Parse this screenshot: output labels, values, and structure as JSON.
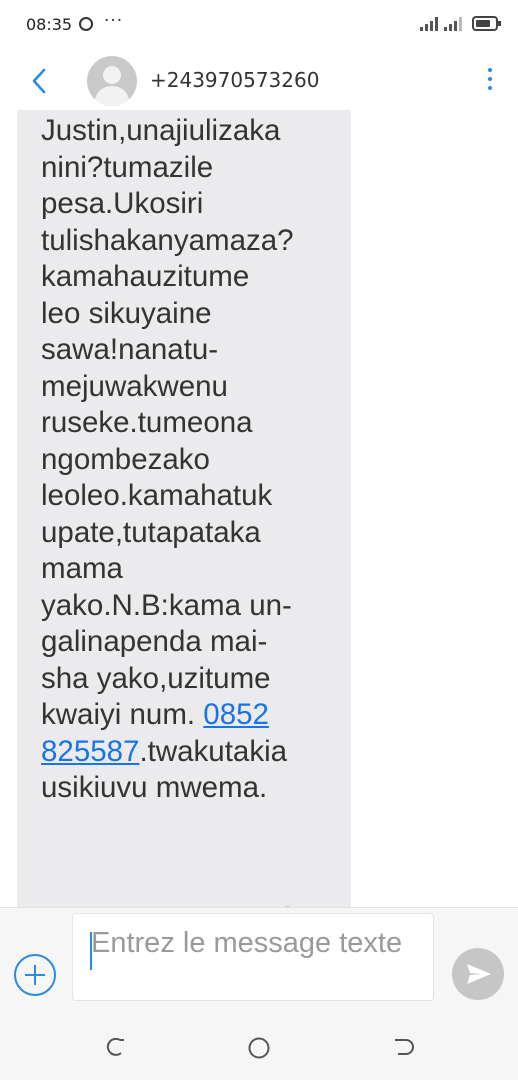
{
  "status_bar": {
    "time": "08:35",
    "more": "···"
  },
  "header": {
    "contact": "+243970573260"
  },
  "message": {
    "text_lines": [
      "Justin,unajiulizaka",
      "nini?tumazile",
      "pesa.Ukosiri",
      "tulishakanyamaza?",
      "kamahauzitume",
      "leo sikuyaine",
      "sawa!nanatu-",
      "mejuwakwenu",
      "ruseke.tumeona",
      "ngombezako",
      "leoleo.kamahatuk",
      "upate,tutapataka",
      "mama",
      "yako.N.B:kama un-",
      "galinapenda mai-",
      "sha yako,uzitume",
      "kwaiyi num. "
    ],
    "link_part1": "0852",
    "link_part2": "825587",
    "after_link": ".twakutakia",
    "last_line": "usikiuvu mwema."
  },
  "composer": {
    "placeholder": "Entrez le message texte"
  },
  "colors": {
    "accent": "#2a8ae6",
    "link": "#1a73e8",
    "bubble": "#ebebee"
  }
}
